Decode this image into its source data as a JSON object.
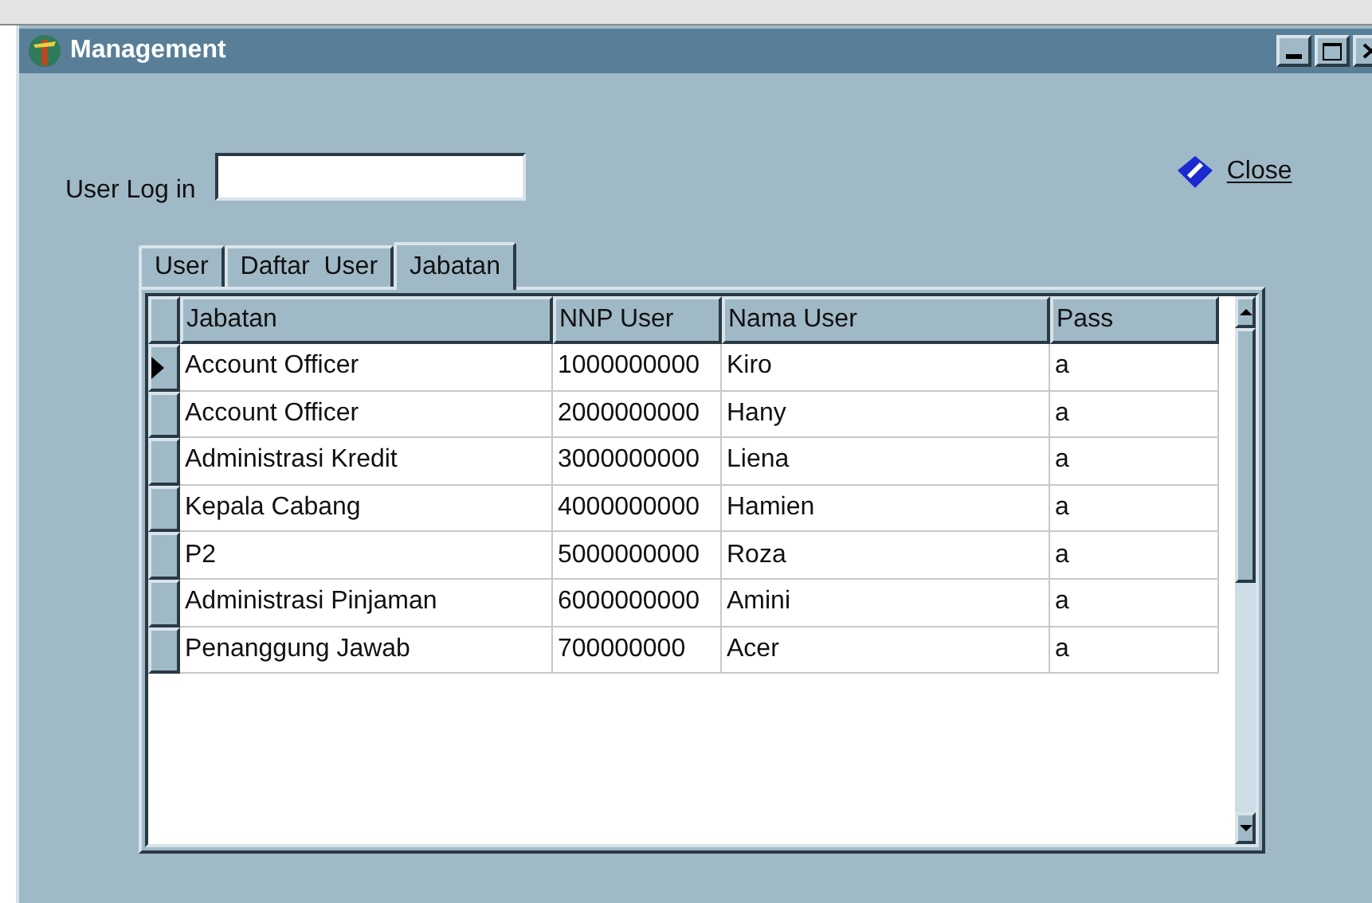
{
  "window": {
    "title": "Management"
  },
  "login": {
    "label": "User Log in"
  },
  "close_button": {
    "label": "Close"
  },
  "tabs": [
    {
      "label": "User",
      "selected": false
    },
    {
      "label": "Daftar  User",
      "selected": false
    },
    {
      "label": "Jabatan",
      "selected": true
    }
  ],
  "table": {
    "columns": [
      "Jabatan",
      "NNP User",
      "Nama User",
      "Pass"
    ],
    "rows": [
      {
        "cells": [
          "Account Officer",
          "1000000000",
          "Kiro",
          "a"
        ],
        "selected": true
      },
      {
        "cells": [
          "Account Officer",
          "2000000000",
          "Hany",
          "a"
        ],
        "selected": false
      },
      {
        "cells": [
          "Administrasi Kredit",
          "3000000000",
          "Liena",
          "a"
        ],
        "selected": false
      },
      {
        "cells": [
          "Kepala Cabang",
          "4000000000",
          "Hamien",
          "a"
        ],
        "selected": false
      },
      {
        "cells": [
          "P2",
          "5000000000",
          "Roza",
          "a"
        ],
        "selected": false
      },
      {
        "cells": [
          "Administrasi Pinjaman",
          "6000000000",
          "Amini",
          "a"
        ],
        "selected": false
      },
      {
        "cells": [
          "Penanggung Jawab",
          "700000000",
          "Acer",
          "a"
        ],
        "selected": false
      }
    ]
  }
}
